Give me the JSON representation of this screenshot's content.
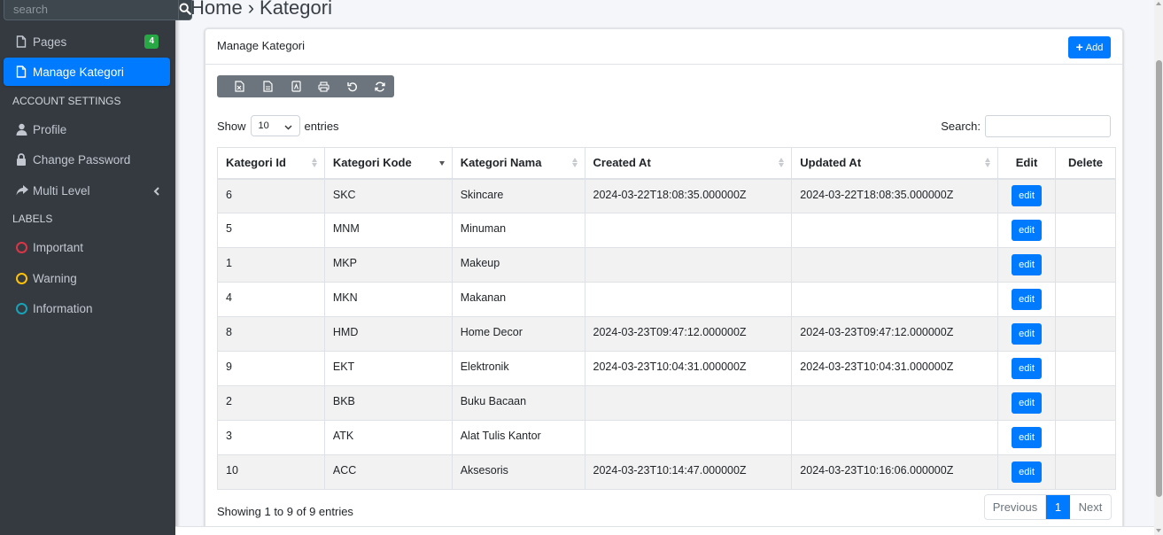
{
  "sidebar": {
    "search_placeholder": "search",
    "items": [
      {
        "label": "Pages",
        "badge": "4"
      },
      {
        "label": "Manage Kategori"
      }
    ],
    "account_header": "ACCOUNT SETTINGS",
    "account_items": [
      {
        "label": "Profile"
      },
      {
        "label": "Change Password"
      },
      {
        "label": "Multi Level"
      }
    ],
    "labels_header": "LABELS",
    "label_items": [
      {
        "label": "Important",
        "color": "#dc3545"
      },
      {
        "label": "Warning",
        "color": "#ffc107"
      },
      {
        "label": "Information",
        "color": "#17a2b8"
      }
    ]
  },
  "breadcrumb": {
    "home": "Home",
    "separator": "›",
    "current": "Kategori"
  },
  "card": {
    "title": "Manage Kategori",
    "add_label": "Add",
    "toolbar_icons": [
      "excel-icon",
      "csv-icon",
      "pdf-icon",
      "print-icon",
      "undo-icon",
      "refresh-icon"
    ],
    "show_label": "Show",
    "entries_label": "entries",
    "page_length": "10",
    "search_label": "Search:",
    "columns": [
      "Kategori Id",
      "Kategori Kode",
      "Kategori Nama",
      "Created At",
      "Updated At",
      "Edit",
      "Delete"
    ],
    "rows": [
      {
        "id": "6",
        "kode": "SKC",
        "nama": "Skincare",
        "created": "2024-03-22T18:08:35.000000Z",
        "updated": "2024-03-22T18:08:35.000000Z"
      },
      {
        "id": "5",
        "kode": "MNM",
        "nama": "Minuman",
        "created": "",
        "updated": ""
      },
      {
        "id": "1",
        "kode": "MKP",
        "nama": "Makeup",
        "created": "",
        "updated": ""
      },
      {
        "id": "4",
        "kode": "MKN",
        "nama": "Makanan",
        "created": "",
        "updated": ""
      },
      {
        "id": "8",
        "kode": "HMD",
        "nama": "Home Decor",
        "created": "2024-03-23T09:47:12.000000Z",
        "updated": "2024-03-23T09:47:12.000000Z"
      },
      {
        "id": "9",
        "kode": "EKT",
        "nama": "Elektronik",
        "created": "2024-03-23T10:04:31.000000Z",
        "updated": "2024-03-23T10:04:31.000000Z"
      },
      {
        "id": "2",
        "kode": "BKB",
        "nama": "Buku Bacaan",
        "created": "",
        "updated": ""
      },
      {
        "id": "3",
        "kode": "ATK",
        "nama": "Alat Tulis Kantor",
        "created": "",
        "updated": ""
      },
      {
        "id": "10",
        "kode": "ACC",
        "nama": "Aksesoris",
        "created": "2024-03-23T10:14:47.000000Z",
        "updated": "2024-03-23T10:16:06.000000Z"
      }
    ],
    "edit_label": "edit",
    "info": "Showing 1 to 9 of 9 entries",
    "pager": {
      "prev": "Previous",
      "current": "1",
      "next": "Next"
    }
  },
  "colors": {
    "primary": "#007bff",
    "sidebar_bg": "#343a40",
    "badge": "#28a745",
    "toolbar": "#6c757d"
  }
}
